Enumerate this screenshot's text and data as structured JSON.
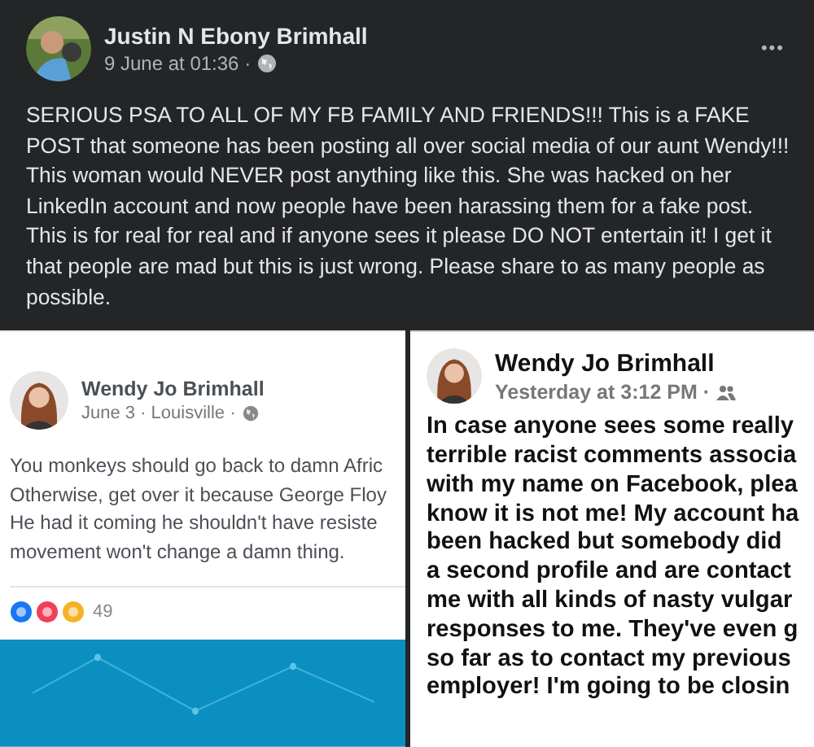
{
  "post": {
    "author": "Justin N Ebony Brimhall",
    "time": "9 June at 01:36 ·",
    "more": "•••",
    "text": "SERIOUS PSA TO ALL OF MY FB FAMILY AND FRIENDS!!! This is a FAKE POST that someone has been posting all over social media of our aunt Wendy!!! This woman would NEVER post anything like this. She was hacked on her LinkedIn account and now people have been harassing them for a fake post. This is for real for real and if anyone sees it please DO NOT entertain it! I get it that people are mad but this is just wrong. Please share to as many people as possible."
  },
  "screenshots": [
    {
      "author": "Wendy Jo Brimhall",
      "time": "June 3 · Louisville ·",
      "kind": "public",
      "lines": [
        "You monkeys should go back to damn Afric",
        "Otherwise, get over it because George Floy",
        "He had it coming he shouldn't have resiste",
        "movement won't change a damn thing."
      ],
      "reaction_count": "49"
    },
    {
      "author": "Wendy Jo Brimhall",
      "time": "Yesterday at 3:12 PM ·",
      "kind": "friends",
      "lines": [
        "In case anyone sees some really",
        "terrible racist comments associa",
        "with my name on Facebook, plea",
        "know it is not me! My account ha",
        "been hacked but somebody did",
        "a second profile and are contact",
        "me with all kinds of nasty vulgar",
        "responses to me. They've even g",
        "so far as to contact my previous",
        "employer! I'm going to be closin"
      ]
    }
  ]
}
